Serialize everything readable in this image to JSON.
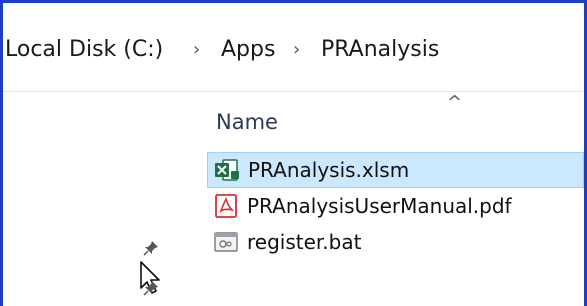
{
  "breadcrumb": {
    "items": [
      "Local Disk (C:)",
      "Apps",
      "PRAnalysis"
    ],
    "separator": "›"
  },
  "file_list": {
    "column_header": "Name",
    "sort_indicator": "^",
    "files": [
      {
        "name": "PRAnalysis.xlsm",
        "icon": "excel-file-icon",
        "selected": true
      },
      {
        "name": "PRAnalysisUserManual.pdf",
        "icon": "pdf-file-icon",
        "selected": false
      },
      {
        "name": "register.bat",
        "icon": "batch-file-icon",
        "selected": false
      }
    ]
  },
  "colors": {
    "frame_border": "#1f3fbf",
    "selection_bg": "#cce8ff",
    "selection_border": "#99d1ff",
    "excel_green": "#1e7145",
    "pdf_red": "#d9302c"
  }
}
